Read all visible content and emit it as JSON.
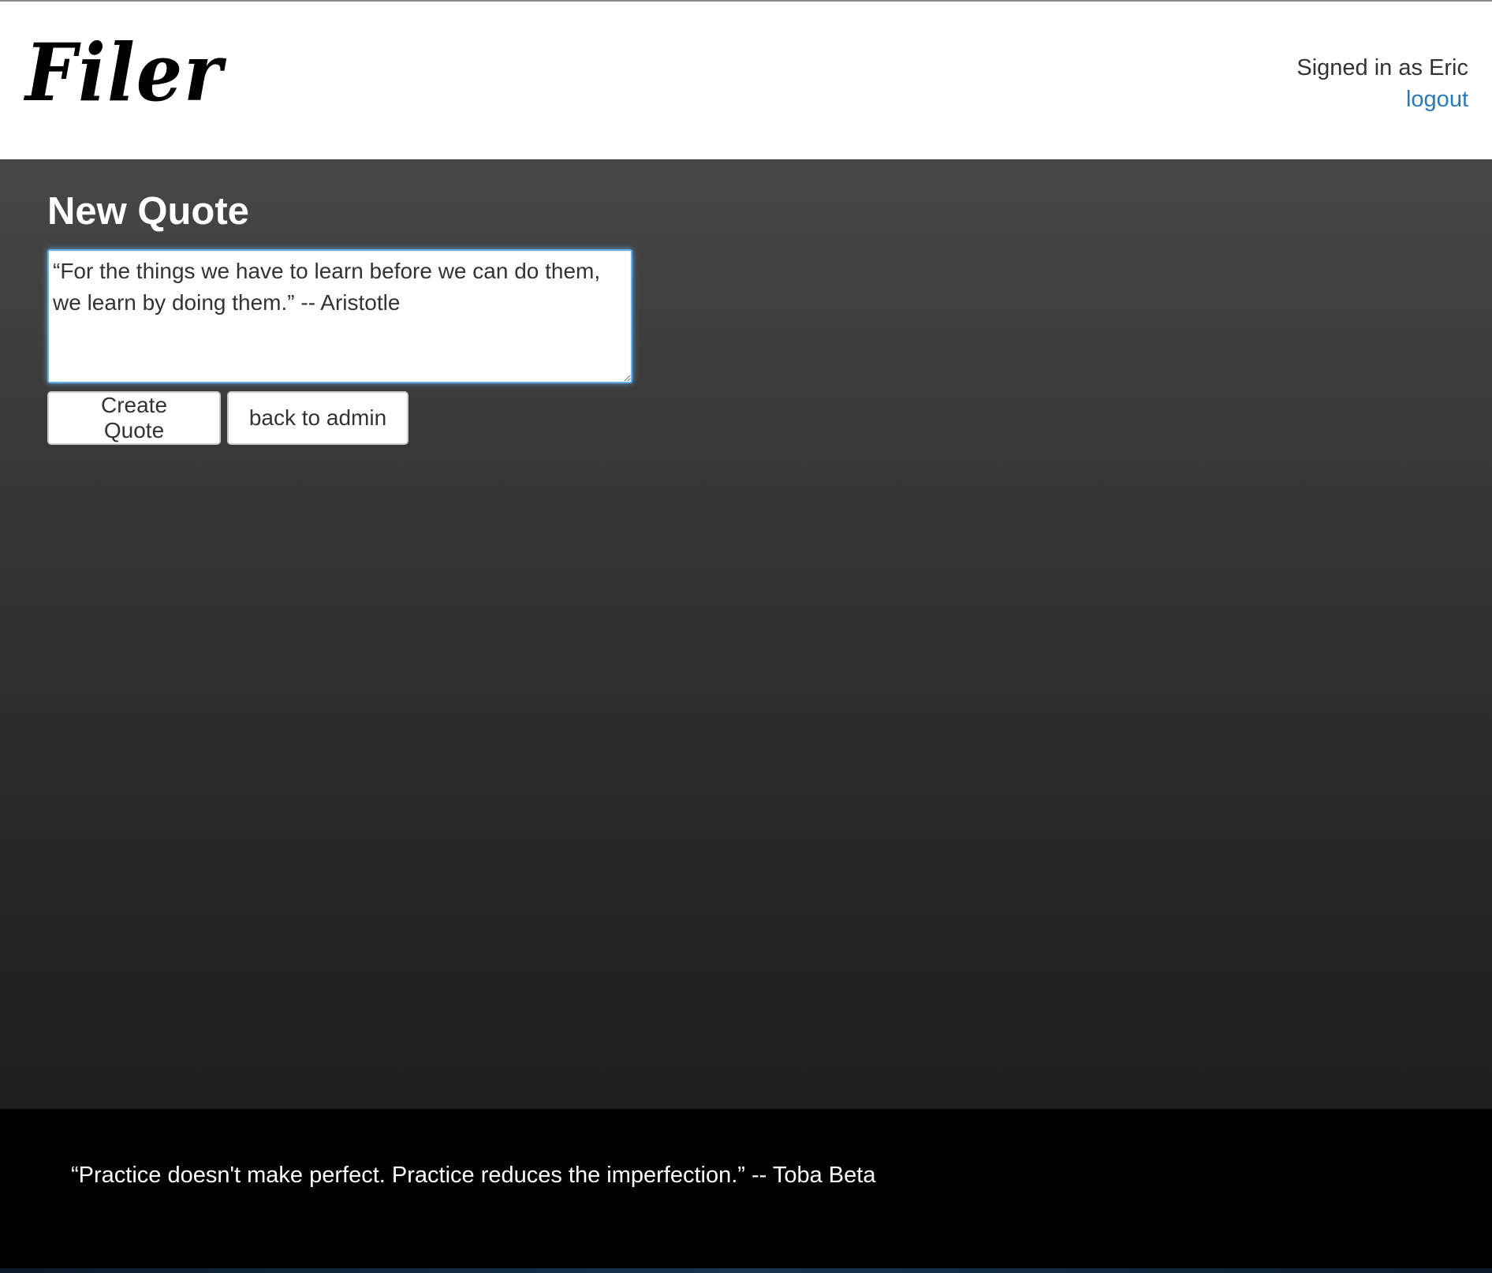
{
  "header": {
    "logo_text": "Filer",
    "signed_in_text": "Signed in as Eric",
    "logout_label": "logout"
  },
  "main": {
    "title": "New Quote",
    "quote_field_value": "“For the things we have to learn before we can do them, we learn by doing them.” -- Aristotle",
    "create_button_label": "Create Quote",
    "back_button_label": "back to admin"
  },
  "footer": {
    "quote_text": "“Practice doesn't make perfect. Practice reduces the imperfection.” -- Toba Beta"
  },
  "colors": {
    "link": "#2a7ab8",
    "focus_ring": "#66afe9",
    "content_bg_top": "#474747",
    "content_bg_bottom": "#1e1e1e",
    "footer_bg": "#000000"
  }
}
